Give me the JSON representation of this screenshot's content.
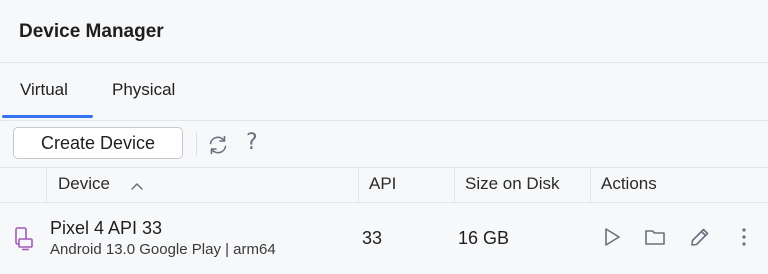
{
  "header": {
    "title": "Device Manager"
  },
  "tabs": [
    {
      "label": "Virtual",
      "selected": true
    },
    {
      "label": "Physical",
      "selected": false
    }
  ],
  "toolbar": {
    "create_label": "Create Device",
    "refresh_icon": "refresh-icon",
    "help_glyph": "?"
  },
  "table": {
    "columns": [
      {
        "label": "Device",
        "sort": "ascending"
      },
      {
        "label": "API"
      },
      {
        "label": "Size on Disk"
      },
      {
        "label": "Actions"
      }
    ],
    "rows": [
      {
        "device_icon": "phone-icon",
        "name": "Pixel 4 API 33",
        "details": "Android 13.0 Google Play | arm64",
        "api": "33",
        "size": "16 GB",
        "actions": [
          "play-icon",
          "folder-icon",
          "edit-icon",
          "more-vertical-icon"
        ]
      }
    ]
  },
  "colors": {
    "accent": "#3574f0",
    "device_icon": "#a35ab8",
    "icon_gray": "#6c707e"
  }
}
